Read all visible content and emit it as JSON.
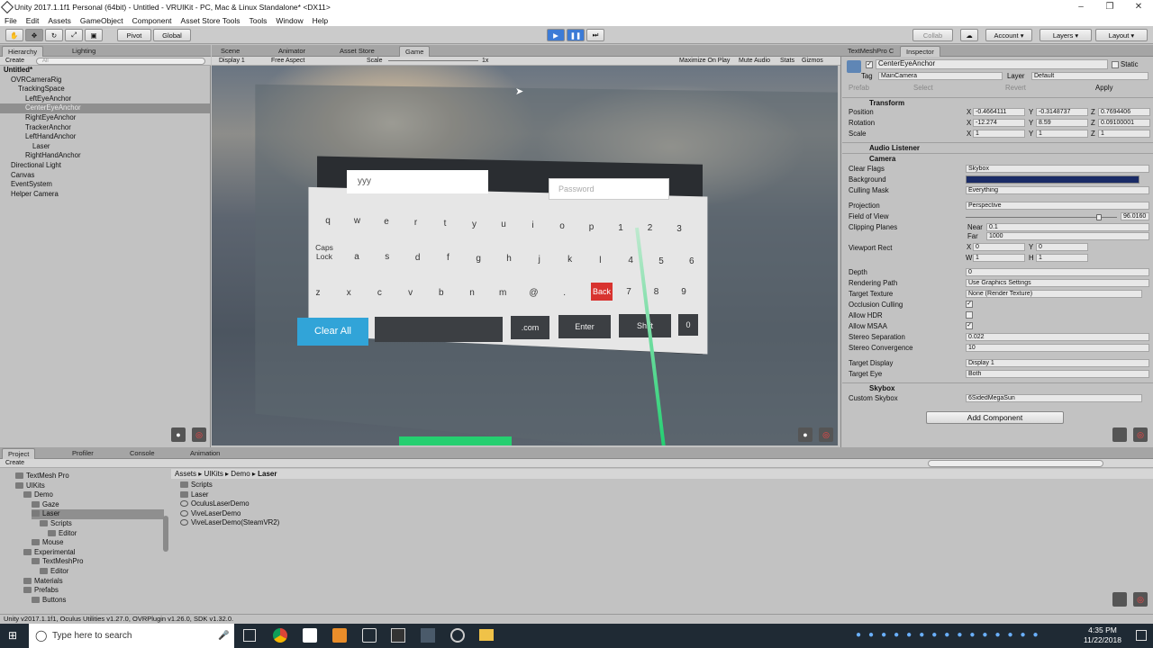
{
  "window": {
    "title": "Unity 2017.1.1f1 Personal (64bit) - Untitled - VRUIKit - PC, Mac & Linux Standalone* <DX11>"
  },
  "menu": [
    "File",
    "Edit",
    "Assets",
    "GameObject",
    "Component",
    "Asset Store Tools",
    "Tools",
    "Window",
    "Help"
  ],
  "toolbar": {
    "pivot": "Pivot",
    "global": "Global",
    "collab": "Collab",
    "account": "Account",
    "layers": "Layers",
    "layout": "Layout"
  },
  "hierarchy": {
    "tabs": [
      "Hierarchy",
      "Lighting"
    ],
    "create": "Create",
    "search_placeholder": "All",
    "rows": [
      {
        "label": "Untitled*",
        "indent": 0
      },
      {
        "label": "OVRCameraRig",
        "indent": 1
      },
      {
        "label": "TrackingSpace",
        "indent": 2
      },
      {
        "label": "LeftEyeAnchor",
        "indent": 3
      },
      {
        "label": "CenterEyeAnchor",
        "indent": 3
      },
      {
        "label": "RightEyeAnchor",
        "indent": 3
      },
      {
        "label": "TrackerAnchor",
        "indent": 3
      },
      {
        "label": "LeftHandAnchor",
        "indent": 3
      },
      {
        "label": "Laser",
        "indent": 4
      },
      {
        "label": "RightHandAnchor",
        "indent": 3
      },
      {
        "label": "Directional Light",
        "indent": 1
      },
      {
        "label": "Canvas",
        "indent": 1
      },
      {
        "label": "EventSystem",
        "indent": 1
      },
      {
        "label": "Helper Camera",
        "indent": 1
      }
    ]
  },
  "center_tabs": [
    "Scene",
    "Animator",
    "Asset Store",
    "Game"
  ],
  "game_bar": {
    "display": "Display 1",
    "aspect": "Free Aspect",
    "scale_label": "Scale",
    "scale_value": "1x",
    "maximize": "Maximize On Play",
    "mute": "Mute Audio",
    "stats": "Stats",
    "gizmos": "Gizmos"
  },
  "vr_keyboard": {
    "username": "yyy",
    "password_placeholder": "Password",
    "row1": [
      "q",
      "w",
      "e",
      "r",
      "t",
      "y",
      "u",
      "i",
      "o",
      "p",
      "1",
      "2",
      "3"
    ],
    "caps": "Caps Lock",
    "row2": [
      "a",
      "s",
      "d",
      "f",
      "g",
      "h",
      "j",
      "k",
      "l",
      "4",
      "5",
      "6"
    ],
    "row3": [
      "z",
      "x",
      "c",
      "v",
      "b",
      "n",
      "m",
      "@",
      "."
    ],
    "back": "Back",
    "row3_nums": [
      "7",
      "8",
      "9"
    ],
    "clear_all": "Clear All",
    "dotcom": ".com",
    "enter": "Enter",
    "shift": "Shift",
    "zero": "0"
  },
  "inspector": {
    "tabs": [
      "TextMeshPro C",
      "Inspector"
    ],
    "object_name": "CenterEyeAnchor",
    "static": "Static",
    "tag_label": "Tag",
    "tag": "MainCamera",
    "layer_label": "Layer",
    "layer": "Default",
    "prefab_label": "Prefab",
    "select": "Select",
    "revert": "Revert",
    "apply": "Apply",
    "transform": {
      "title": "Transform",
      "position_label": "Position",
      "px": "-0.4664111",
      "py": "-0.3148737",
      "pz": "0.7694406",
      "rotation_label": "Rotation",
      "rx": "-12.274",
      "ry": "8.59",
      "rz": "0.09100001",
      "scale_label": "Scale",
      "sx": "1",
      "sy": "1",
      "sz": "1"
    },
    "audio_listener": "Audio Listener",
    "camera": {
      "title": "Camera",
      "clear_flags_label": "Clear Flags",
      "clear_flags": "Skybox",
      "background_label": "Background",
      "background_color": "#1a2b66",
      "culling_label": "Culling Mask",
      "culling": "Everything",
      "projection_label": "Projection",
      "projection": "Perspective",
      "fov_label": "Field of View",
      "fov": "96.0160",
      "fov_fraction": 0.88,
      "clip_label": "Clipping Planes",
      "near_label": "Near",
      "near": "0.1",
      "far_label": "Far",
      "far": "1000",
      "viewport_label": "Viewport Rect",
      "vx": "0",
      "vy": "0",
      "vw": "1",
      "vh": "1",
      "depth_label": "Depth",
      "depth": "0",
      "render_path_label": "Rendering Path",
      "render_path": "Use Graphics Settings",
      "target_tex_label": "Target Texture",
      "target_tex": "None (Render Texture)",
      "occlusion_label": "Occlusion Culling",
      "hdr_label": "Allow HDR",
      "msaa_label": "Allow MSAA",
      "stereo_sep_label": "Stereo Separation",
      "stereo_sep": "0.022",
      "stereo_conv_label": "Stereo Convergence",
      "stereo_conv": "10",
      "target_display_label": "Target Display",
      "target_display": "Display 1",
      "target_eye_label": "Target Eye",
      "target_eye": "Both"
    },
    "skybox": {
      "title": "Skybox",
      "custom_label": "Custom Skybox",
      "custom": "6SidedMegaSun"
    },
    "add_component": "Add Component"
  },
  "bottom_tabs": [
    "Project",
    "Profiler",
    "Console",
    "Animation"
  ],
  "project": {
    "create": "Create",
    "tree": [
      {
        "label": "TextMesh Pro",
        "indent": 1
      },
      {
        "label": "UIKits",
        "indent": 1
      },
      {
        "label": "Demo",
        "indent": 2
      },
      {
        "label": "Gaze",
        "indent": 3
      },
      {
        "label": "Laser",
        "indent": 3
      },
      {
        "label": "Scripts",
        "indent": 4
      },
      {
        "label": "Editor",
        "indent": 5
      },
      {
        "label": "Mouse",
        "indent": 3
      },
      {
        "label": "Experimental",
        "indent": 2
      },
      {
        "label": "TextMeshPro",
        "indent": 3
      },
      {
        "label": "Editor",
        "indent": 4
      },
      {
        "label": "Materials",
        "indent": 2
      },
      {
        "label": "Prefabs",
        "indent": 2
      },
      {
        "label": "Buttons",
        "indent": 3
      }
    ],
    "breadcrumb": [
      "Assets",
      "UIKits",
      "Demo",
      "Laser"
    ],
    "files": [
      "Scripts",
      "Laser",
      "OculusLaserDemo",
      "ViveLaserDemo",
      "ViveLaserDemo(SteamVR2)"
    ]
  },
  "status": "Unity v2017.1.1f1, Oculus Utilities v1.27.0, OVRPlugin v1.26.0, SDK v1.32.0.",
  "taskbar": {
    "search_placeholder": "Type here to search",
    "time": "4:35 PM",
    "date": "11/22/2018"
  }
}
